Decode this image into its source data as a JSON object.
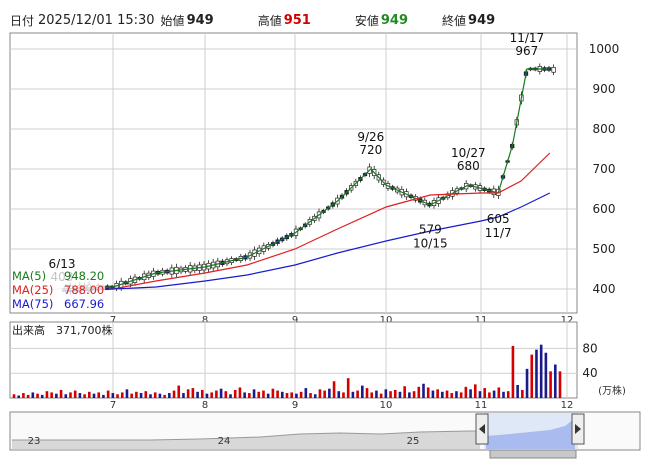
{
  "header": {
    "date_label": "日付",
    "datetime": "2025/12/01 15:30",
    "open_label": "始値",
    "open": "949",
    "high_label": "高値",
    "high": "951",
    "low_label": "安値",
    "low": "949",
    "close_label": "終値",
    "close": "949"
  },
  "legend": {
    "ma5": "MA(5)",
    "ma5_val": "948.20",
    "ma25": "MA(25)",
    "ma25_val": "788.00",
    "ma75": "MA(75)",
    "ma75_val": "667.96"
  },
  "volume_panel": {
    "title": "出来高",
    "value": "371,700株",
    "unit": "(万株)"
  },
  "colors": {
    "up": "#d40000",
    "down": "#1a1a8c",
    "ma5": "#1a7a1a",
    "ma25": "#e02020",
    "ma75": "#1a1ad0",
    "grid": "#cfcfcf"
  },
  "chart_data": [
    {
      "type": "line",
      "title": "",
      "xlabel": "",
      "ylabel": "",
      "x_ticks": [
        "7",
        "8",
        "9",
        "10",
        "11",
        "12"
      ],
      "y_ticks": [
        "400",
        "500",
        "600",
        "700",
        "800",
        "900",
        "1000"
      ],
      "ylim": [
        340,
        1040
      ],
      "grid": true,
      "series": [
        {
          "name": "MA(5)",
          "value_label": "948.20",
          "x": [
            "6/13",
            "7/1",
            "7/15",
            "8/1",
            "8/15",
            "9/1",
            "9/15",
            "9/26",
            "10/1",
            "10/15",
            "10/27",
            "11/7",
            "11/12",
            "11/17",
            "11/25",
            "12/1"
          ],
          "values": [
            400,
            405,
            440,
            455,
            480,
            540,
            620,
            700,
            660,
            610,
            660,
            640,
            760,
            950,
            950,
            948
          ]
        },
        {
          "name": "MA(25)",
          "value_label": "788.00",
          "x": [
            "6/13",
            "7/1",
            "7/15",
            "8/1",
            "8/15",
            "9/1",
            "9/15",
            "10/1",
            "10/15",
            "11/1",
            "11/7",
            "11/15",
            "11/25",
            "12/1"
          ],
          "values": [
            395,
            400,
            420,
            440,
            460,
            500,
            550,
            605,
            635,
            640,
            640,
            670,
            740,
            788
          ]
        },
        {
          "name": "MA(75)",
          "value_label": "667.96",
          "x": [
            "6/13",
            "7/1",
            "7/15",
            "8/1",
            "8/15",
            "9/1",
            "9/15",
            "10/1",
            "10/15",
            "11/1",
            "11/7",
            "11/15",
            "11/25",
            "12/1"
          ],
          "values": [
            395,
            400,
            405,
            420,
            435,
            460,
            490,
            520,
            545,
            570,
            580,
            605,
            640,
            668
          ]
        }
      ],
      "annotations": [
        {
          "label": "6/13",
          "value": "403"
        },
        {
          "label": "9/26",
          "value": "720"
        },
        {
          "label": "10/27",
          "value": "680"
        },
        {
          "label": "11/17",
          "value": "967"
        },
        {
          "label": "10/15",
          "value": "579"
        },
        {
          "label": "11/7",
          "value": "605"
        }
      ]
    },
    {
      "type": "bar",
      "title": "",
      "xlabel": "",
      "ylabel": "",
      "y_ticks": [
        "40",
        "80"
      ],
      "ylim": [
        0,
        100
      ],
      "unit": "(万株)",
      "x_ticks": [
        "7",
        "8",
        "9",
        "10",
        "11",
        "12"
      ],
      "values": [
        6,
        4,
        8,
        5,
        9,
        7,
        5,
        11,
        9,
        7,
        13,
        6,
        9,
        12,
        8,
        6,
        10,
        7,
        9,
        5,
        12,
        8,
        6,
        9,
        14,
        7,
        10,
        8,
        11,
        6,
        9,
        7,
        5,
        8,
        12,
        20,
        8,
        14,
        16,
        10,
        13,
        7,
        9,
        12,
        15,
        11,
        6,
        13,
        17,
        9,
        8,
        14,
        10,
        12,
        7,
        15,
        12,
        10,
        8,
        9,
        7,
        10,
        16,
        8,
        6,
        14,
        12,
        15,
        27,
        11,
        9,
        32,
        10,
        12,
        20,
        16,
        9,
        12,
        7,
        14,
        11,
        13,
        10,
        19,
        9,
        11,
        18,
        23,
        17,
        12,
        14,
        10,
        12,
        8,
        11,
        9,
        18,
        14,
        22,
        11,
        16,
        9,
        12,
        17,
        10,
        11,
        84,
        21,
        13,
        47,
        70,
        78,
        86,
        73,
        43,
        54,
        43
      ],
      "up_flags": [
        1,
        0,
        1,
        1,
        0,
        1,
        0,
        1,
        1,
        0,
        1,
        0,
        1,
        1,
        0,
        1,
        1,
        0,
        1,
        0,
        1,
        0,
        1,
        1,
        0,
        1,
        1,
        0,
        1,
        0,
        1,
        0,
        1,
        0,
        1,
        1,
        0,
        1,
        1,
        0,
        1,
        0,
        1,
        1,
        0,
        1,
        0,
        1,
        1,
        0,
        1,
        0,
        1,
        1,
        0,
        1,
        1,
        0,
        1,
        1,
        0,
        1,
        0,
        1,
        0,
        1,
        1,
        0,
        1,
        0,
        1,
        1,
        0,
        1,
        0,
        1,
        1,
        0,
        1,
        0,
        1,
        1,
        0,
        1,
        0,
        1,
        1,
        0,
        1,
        0,
        1,
        0,
        1,
        1,
        0,
        1,
        1,
        0,
        1,
        0,
        1,
        1,
        0,
        1,
        0,
        1,
        1,
        0,
        1,
        0,
        1,
        0,
        0,
        0,
        1,
        0,
        1
      ]
    }
  ],
  "navigator": {
    "year_labels": [
      "23",
      "24",
      "25"
    ]
  }
}
